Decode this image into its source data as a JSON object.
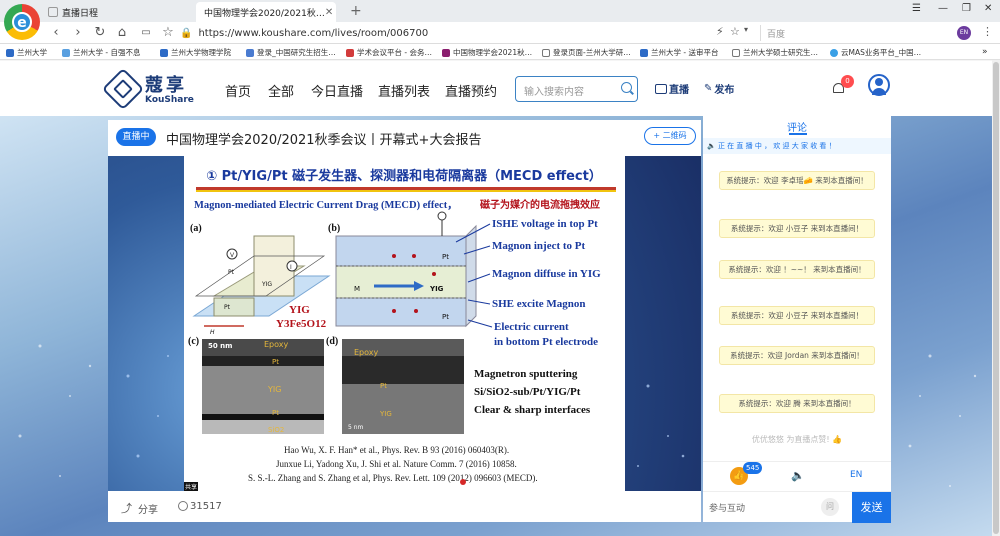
{
  "browser": {
    "tabs": [
      {
        "title": "直播日程",
        "active": false
      },
      {
        "title": "中国物理学会2020/2021秋…",
        "active": true
      }
    ],
    "url": "https://www.koushare.com/lives/room/006700",
    "search_engine": "百度",
    "profile_initials": "EN",
    "bookmarks": [
      "兰州大学",
      "兰州大学 - 自强不息",
      "兰州大学物理学院",
      "登录_中国研究生招生…",
      "学术会议平台 - 会务…",
      "中国物理学会2021秋…",
      "登录页面-兰州大学研…",
      "兰州大学 - 送审平台",
      "兰州大学硕士研究生…",
      "云MAS业务平台_中国…"
    ]
  },
  "site": {
    "logo_cn": "蔻享",
    "logo_en": "KouShare",
    "nav": [
      "首页",
      "全部",
      "今日直播",
      "直播列表",
      "直播预约"
    ],
    "search_placeholder": "输入搜索内容",
    "live_button": "直播",
    "publish_button": "发布",
    "notification_count": "0"
  },
  "room": {
    "status": "直播中",
    "title": "中国物理学会2020/2021秋季会议丨开幕式+大会报告",
    "qr_label": "+ 二维码",
    "share_label": "分享",
    "views": "31517"
  },
  "slide": {
    "heading": "① Pt/YIG/Pt 磁子发生器、探测器和电荷隔离器（MECD effect）",
    "subheading_en": "Magnon-mediated Electric Current Drag (MECD) effect，",
    "subheading_cn": "磁子为媒介的电流拖拽效应",
    "panels": [
      "(a)",
      "(b)",
      "(c)",
      "(d)"
    ],
    "yig_label": "YIG",
    "yig_formula": "Y3Fe5O12",
    "right_labels": [
      "ISHE voltage in top Pt",
      "Magnon inject to Pt",
      "Magnon diffuse in YIG",
      "SHE excite Magnon",
      "Electric current",
      "in bottom Pt electrode"
    ],
    "tem_labels_c": [
      "50 nm",
      "Epoxy",
      "Pt",
      "YIG",
      "Pt",
      "SiO2"
    ],
    "tem_labels_d": [
      "Epoxy",
      "Pt",
      "YIG",
      "5 nm"
    ],
    "sputter_lines": [
      "Magnetron sputtering",
      "Si/SiO2-sub/Pt/YIG/Pt",
      "Clear & sharp interfaces"
    ],
    "refs": [
      "Hao Wu, X. F. Han* et al., Phys. Rev. B 93 (2016) 060403(R).",
      "Junxue Li, Yadong Xu, J. Shi et al. Nature Comm. 7 (2016) 10858.",
      "S. S.-L. Zhang and S. Zhang et al, Phys. Rev. Lett. 109 (2012) 096603 (MECD)."
    ],
    "share_tag": "共享"
  },
  "chat": {
    "title": "评论",
    "notice": "正 在 直 播 中 ， 欢 迎 大 家 收 看 ！",
    "messages": [
      "系统提示：欢迎 李卓瑶🧀 来到本直播间！",
      "系统提示：欢迎 小豆子 来到本直播间！",
      "系统提示：欢迎 ！~~！ 来到本直播间！",
      "系统提示：欢迎 小豆子 来到本直播间！",
      "系统提示：欢迎 Jordan 来到本直播间！",
      "系统提示：欢迎 腾 来到本直播间！"
    ],
    "like_text": "优优悠悠 为直播点赞!",
    "like_count": "545",
    "lang": "EN",
    "input_placeholder": "参与互动",
    "ask_label": "问",
    "send": "发送"
  },
  "colors": {
    "accent": "#1a73e8",
    "brand": "#1d3c78",
    "slide_title": "#1a3a9e",
    "slide_red": "#b3131b"
  }
}
